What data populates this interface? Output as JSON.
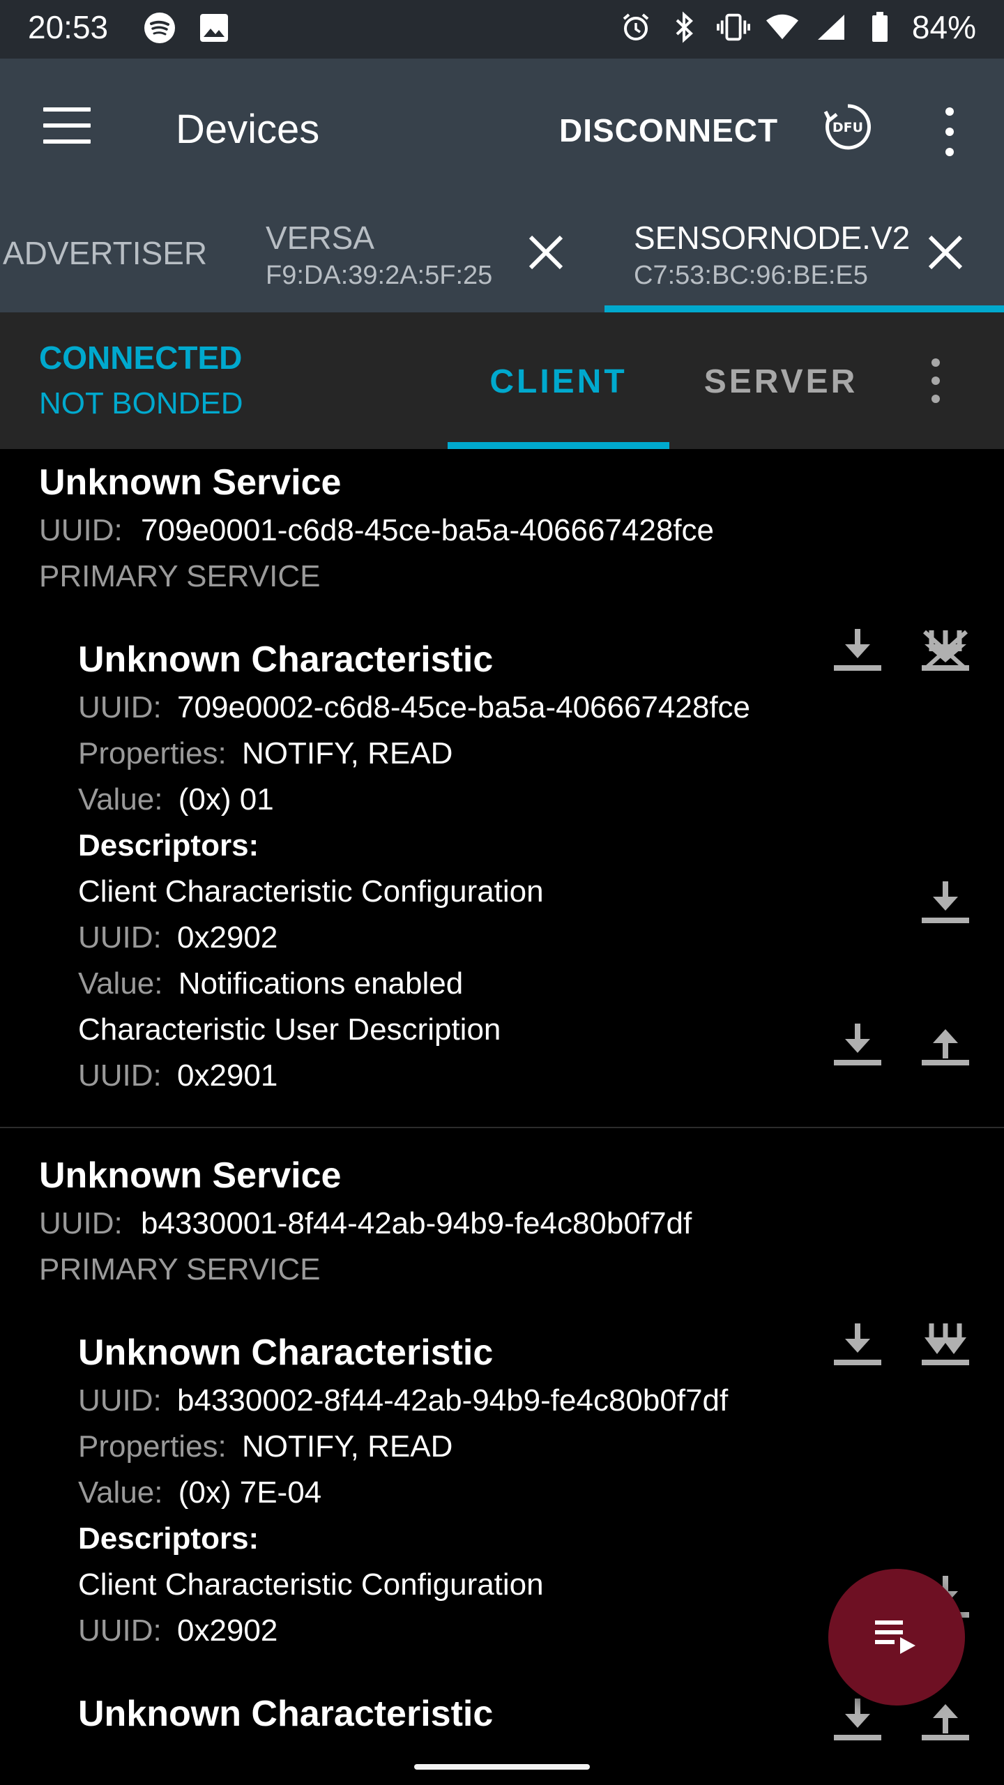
{
  "status_bar": {
    "time": "20:53",
    "battery": "84%",
    "left_icons": [
      "spotify-icon",
      "image-icon"
    ],
    "right_icons": [
      "alarm-icon",
      "bluetooth-icon",
      "vibrate-icon",
      "wifi-icon",
      "signal-icon",
      "battery-icon"
    ]
  },
  "appbar": {
    "title": "Devices",
    "disconnect_label": "DISCONNECT",
    "dfu_label": "DFU"
  },
  "device_tabs": [
    {
      "name": "ADVERTISER",
      "mac": ""
    },
    {
      "name": "VERSA",
      "mac": "F9:DA:39:2A:5F:25"
    },
    {
      "name": "SENSORNODE.V2",
      "mac": "C7:53:BC:96:BE:E5",
      "selected": true
    }
  ],
  "connection": {
    "state": "CONNECTED",
    "bond": "NOT BONDED",
    "tabs": [
      "CLIENT",
      "SERVER"
    ],
    "active_tab": "CLIENT"
  },
  "labels": {
    "uuid": "UUID:",
    "properties": "Properties:",
    "value": "Value:",
    "descriptors": "Descriptors:"
  },
  "services": [
    {
      "title": "Unknown Service",
      "uuid": "709e0001-c6d8-45ce-ba5a-406667428fce",
      "type": "PRIMARY SERVICE",
      "characteristic": {
        "title": "Unknown Characteristic",
        "uuid": "709e0002-c6d8-45ce-ba5a-406667428fce",
        "properties": "NOTIFY, READ",
        "value": "(0x) 01",
        "descriptors": [
          {
            "name": "Client Characteristic Configuration",
            "uuid": "0x2902",
            "value": "Notifications enabled"
          },
          {
            "name": "Characteristic User Description",
            "uuid": "0x2901"
          }
        ]
      }
    },
    {
      "title": "Unknown Service",
      "uuid": "b4330001-8f44-42ab-94b9-fe4c80b0f7df",
      "type": "PRIMARY SERVICE",
      "characteristic": {
        "title": "Unknown Characteristic",
        "uuid": "b4330002-8f44-42ab-94b9-fe4c80b0f7df",
        "properties": "NOTIFY, READ",
        "value": "(0x) 7E-04",
        "descriptors": [
          {
            "name": "Client Characteristic Configuration",
            "uuid": "0x2902"
          }
        ]
      },
      "next_characteristic_title": "Unknown Characteristic"
    }
  ],
  "colors": {
    "accent": "#00a9ce",
    "appbar": "#37414b",
    "statusbar": "#262b31",
    "fab": "#6e1023"
  }
}
